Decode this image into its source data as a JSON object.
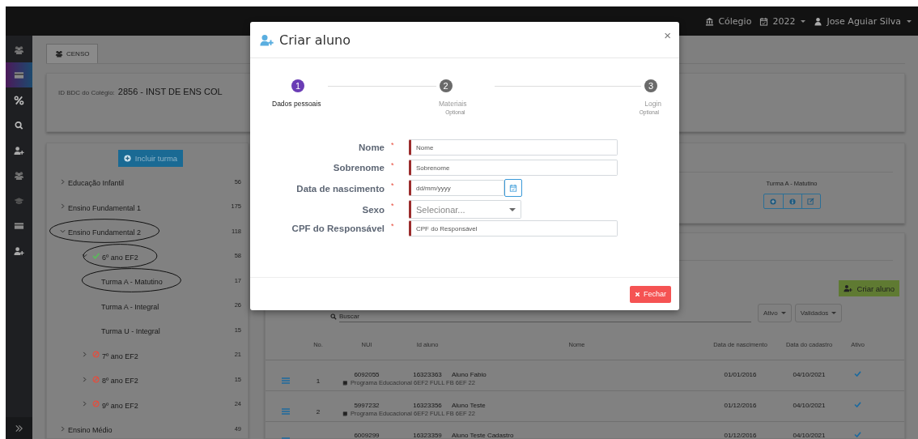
{
  "header": {
    "school": "Cólegio",
    "year": "2022",
    "user": "Jose Aguiar Silva"
  },
  "sidebar": {
    "items": [
      {
        "selected": false
      },
      {
        "selected": true
      },
      {
        "selected": false
      },
      {
        "selected": false
      },
      {
        "selected": false
      },
      {
        "selected": false
      },
      {
        "selected": false
      },
      {
        "selected": false
      },
      {
        "selected": false
      }
    ]
  },
  "tabs": [
    {
      "label": "CENSO",
      "selected": true
    }
  ],
  "school_card": {
    "label": "ID BDC do Colégio:",
    "value": "2856 - INST DE ENS COL"
  },
  "tree": {
    "button": "Incluir turma",
    "items": [
      {
        "label": "Educação Infantil",
        "count": "56",
        "expanded": false,
        "circled": false
      },
      {
        "label": "Ensino Fundamental 1",
        "count": "175",
        "expanded": false,
        "circled": false
      },
      {
        "label": "Ensino Fundamental 2",
        "count": "118",
        "expanded": true,
        "circled": true,
        "children": [
          {
            "label": "6º ano EF2",
            "count": "58",
            "expanded": true,
            "kind": "ok",
            "circled": true,
            "children": [
              {
                "label": "Turma A - Matutino",
                "count": "17",
                "circled": true
              },
              {
                "label": "Turma A - Integral",
                "count": "26",
                "circled": false
              },
              {
                "label": "Turma U - Integral",
                "count": "15",
                "circled": false
              }
            ]
          },
          {
            "label": "7º ano EF2",
            "count": "21",
            "expanded": false,
            "kind": "blocked",
            "circled": false
          },
          {
            "label": "8º ano EF2",
            "count": "15",
            "expanded": false,
            "kind": "blocked",
            "circled": false
          },
          {
            "label": "9º ano EF2",
            "count": "24",
            "expanded": false,
            "kind": "blocked",
            "circled": false
          }
        ]
      },
      {
        "label": "Ensino Médio",
        "count": "49",
        "expanded": false,
        "circled": false
      }
    ]
  },
  "class_card": {
    "title": "Turma A - Matutino"
  },
  "students": {
    "create_button": "Criar aluno",
    "search_placeholder": "Buscar",
    "filters": [
      "Ativo",
      "Validados"
    ],
    "columns": [
      "No.",
      "NUI",
      "Id aluno",
      "Nome",
      "Data de nascimento",
      "Data do cadastro",
      "Ativo"
    ],
    "rows": [
      {
        "no": "1",
        "nui": "6092055",
        "id": "16323363",
        "name": "Aluno Fabio",
        "birth": "01/01/2016",
        "registered": "04/10/2021",
        "active": true,
        "program": "Programa Educacional 6EF2 FULL FB 6EF 22"
      },
      {
        "no": "2",
        "nui": "5997232",
        "id": "16323356",
        "name": "Aluno Teste",
        "birth": "01/12/2016",
        "registered": "04/10/2021",
        "active": true,
        "program": "Programa Educacional 6EF2 FULL FB 6EF 22"
      },
      {
        "nui": "6009299",
        "id": "16323359",
        "name": "Aluno Teste Cadastro",
        "birth": "01/12/2016",
        "registered": "04/10/2021",
        "active": true
      }
    ]
  },
  "modal": {
    "title": "Criar aluno",
    "close": "×",
    "steps": [
      {
        "number": "1",
        "label": "Dados pessoais",
        "selected": true
      },
      {
        "number": "2",
        "label": "Materiais",
        "sublabel": "Optional",
        "selected": false
      },
      {
        "number": "3",
        "label": "Login",
        "sublabel": "Optional",
        "selected": false
      }
    ],
    "fields": [
      {
        "kind": "text",
        "label": "Nome",
        "required_mark": "*",
        "placeholder": "Nome"
      },
      {
        "kind": "text",
        "label": "Sobrenome",
        "required_mark": "*",
        "placeholder": "Sobrenome"
      },
      {
        "kind": "date",
        "label": "Data de nascimento",
        "required_mark": "*",
        "placeholder": "dd/mm/yyyy"
      },
      {
        "kind": "select",
        "label": "Sexo",
        "required_mark": "*",
        "placeholder": "Selecionar..."
      },
      {
        "kind": "text",
        "label": "CPF do Responsável",
        "required_mark": "*",
        "placeholder": "CPF do Responsável"
      }
    ],
    "close_button": "Fechar"
  }
}
